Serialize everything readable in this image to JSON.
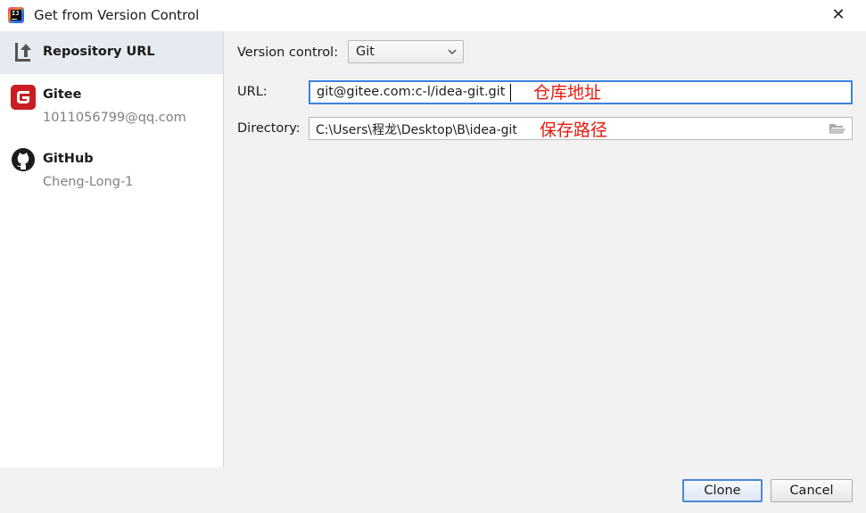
{
  "window": {
    "title": "Get from Version Control",
    "close_icon": "close-icon"
  },
  "sidebar": {
    "items": [
      {
        "label": "Repository URL",
        "sub": "",
        "icon": "repository-url-icon",
        "selected": true
      },
      {
        "label": "Gitee",
        "sub": "1011056799@qq.com",
        "icon": "gitee-logo-icon",
        "selected": false,
        "icon_color": "#c71d23"
      },
      {
        "label": "GitHub",
        "sub": "Cheng-Long-1",
        "icon": "github-logo-icon",
        "selected": false
      }
    ]
  },
  "form": {
    "version_control_label": "Version control:",
    "version_control_value": "Git",
    "url_label": "URL:",
    "url_value": "git@gitee.com:c-l/idea-git.git",
    "directory_label": "Directory:",
    "directory_value": "C:\\Users\\程龙\\Desktop\\B\\idea-git",
    "folder_icon": "folder-open-icon"
  },
  "annotations": {
    "url_note": "仓库地址",
    "directory_note": "保存路径",
    "color": "#e8180c"
  },
  "buttons": {
    "clone": "Clone",
    "cancel": "Cancel"
  },
  "colors": {
    "accent": "#3d82dc",
    "selected_bg": "#e6ebf2"
  }
}
